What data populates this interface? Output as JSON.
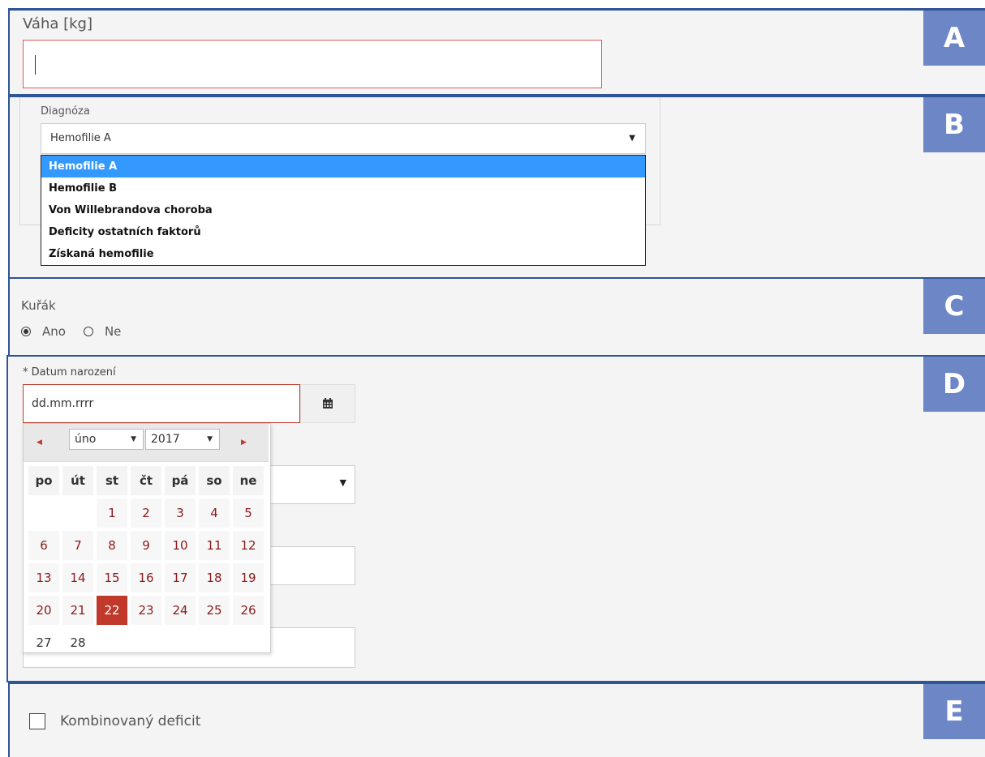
{
  "panels": {
    "a": {
      "badge": "A",
      "label": "Váha [kg]",
      "value": ""
    },
    "b": {
      "badge": "B",
      "label": "Diagnóza",
      "selected": "Hemofilie A",
      "options": [
        "Hemofilie A",
        "Hemofilie B",
        "Von Willebrandova choroba",
        "Deficity ostatních faktorů",
        "Získaná hemofilie"
      ]
    },
    "c": {
      "badge": "C",
      "label": "Kuřák",
      "options": [
        "Ano",
        "Ne"
      ],
      "selected": "Ano"
    },
    "d": {
      "badge": "D",
      "label": "* Datum narození",
      "placeholder": "dd.mm.rrrr",
      "datepicker": {
        "month": "úno",
        "year": "2017",
        "weekdays": [
          "po",
          "út",
          "st",
          "čt",
          "pá",
          "so",
          "ne"
        ],
        "weeks": [
          [
            "",
            "",
            "1",
            "2",
            "3",
            "4",
            "5"
          ],
          [
            "6",
            "7",
            "8",
            "9",
            "10",
            "11",
            "12"
          ],
          [
            "13",
            "14",
            "15",
            "16",
            "17",
            "18",
            "19"
          ],
          [
            "20",
            "21",
            "22",
            "23",
            "24",
            "25",
            "26"
          ],
          [
            "27",
            "28",
            "",
            "",
            "",
            "",
            ""
          ]
        ],
        "today": "22"
      }
    },
    "e": {
      "badge": "E",
      "label": "Kombinovaný deficit",
      "checked": false
    }
  },
  "colors": {
    "frame": "#2f5597",
    "badge": "#6d87c6",
    "error": "#c0392b",
    "selection": "#3399ff"
  }
}
